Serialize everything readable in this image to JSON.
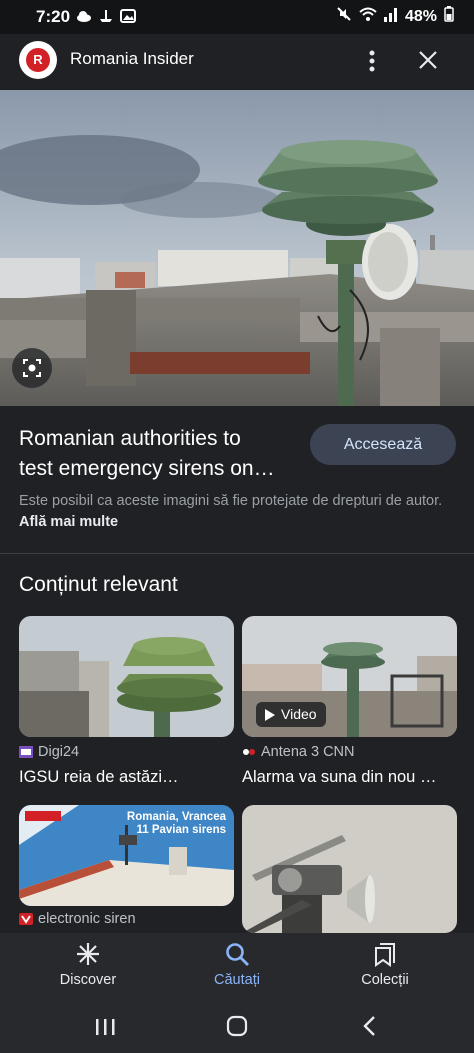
{
  "status_bar": {
    "time": "7:20",
    "battery": "48%"
  },
  "header": {
    "logo_letter": "R",
    "site_name": "Romania Insider"
  },
  "article": {
    "title_line1": "Romanian authorities to",
    "title_line2": "test emergency sirens on…",
    "visit_button": "Accesează",
    "disclaimer": "Este posibil ca aceste imagini să fie protejate de drepturi de autor.",
    "learn_more": "Află mai multe"
  },
  "related": {
    "heading": "Conținut relevant",
    "cards": [
      {
        "source": "Digi24",
        "title": "IGSU reia de astăzi…"
      },
      {
        "source": "Antena 3 CNN",
        "title": "Alarma va suna din nou …",
        "badge": "Video"
      },
      {
        "source": "electronic siren",
        "title": "",
        "image_caption_line1": "Romania, Vrancea",
        "image_caption_line2": "11 Pavian sirens"
      },
      {
        "source": "",
        "title": ""
      }
    ]
  },
  "bottom_nav": {
    "items": [
      {
        "label": "Discover",
        "active": false
      },
      {
        "label": "Căutați",
        "active": true
      },
      {
        "label": "Colecții",
        "active": false
      }
    ]
  },
  "colors": {
    "background": "#202124",
    "accent": "#8ab4f8",
    "button_bg": "#3c4454",
    "logo_red": "#d32027"
  }
}
